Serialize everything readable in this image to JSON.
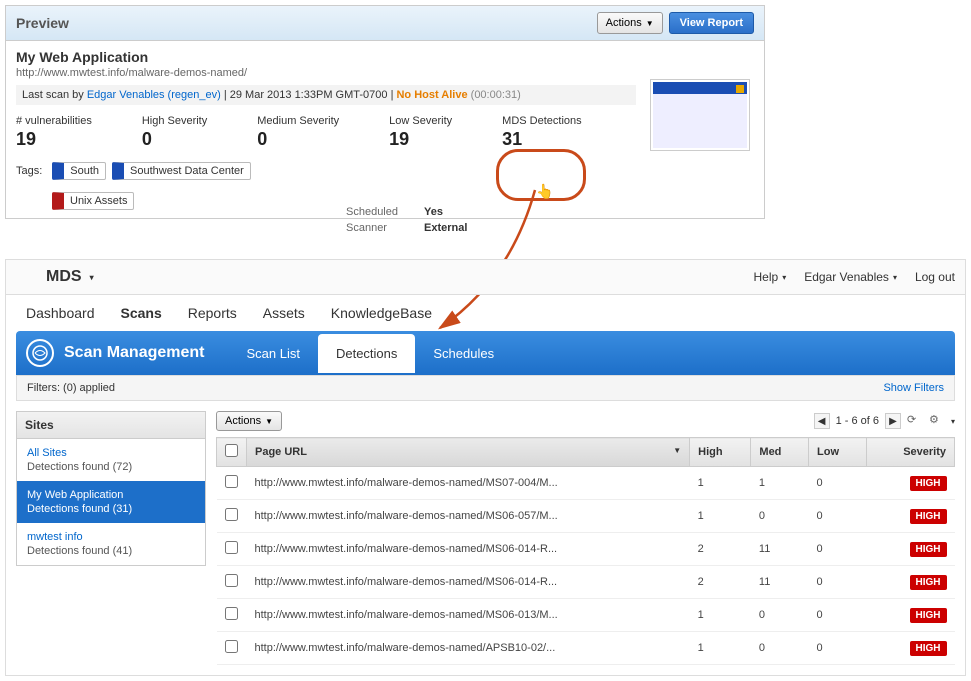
{
  "preview": {
    "title": "Preview",
    "actions_label": "Actions",
    "view_report_label": "View Report",
    "app_name": "My Web Application",
    "app_url": "http://www.mwtest.info/malware-demos-named/",
    "scan_prefix": "Last scan by ",
    "scan_user": "Edgar Venables (regen_ev)",
    "scan_sep1": " | ",
    "scan_date": "29 Mar 2013 1:33PM GMT-0700",
    "scan_sep2": " | ",
    "scan_status": "No Host Alive",
    "scan_duration": "(00:00:31)",
    "stats": [
      {
        "label": "# vulnerabilities",
        "value": "19"
      },
      {
        "label": "High Severity",
        "value": "0"
      },
      {
        "label": "Medium Severity",
        "value": "0"
      },
      {
        "label": "Low Severity",
        "value": "19"
      },
      {
        "label": "MDS Detections",
        "value": "31"
      }
    ],
    "tags_label": "Tags:",
    "tags": [
      {
        "text": "South",
        "color": "blue"
      },
      {
        "text": "Southwest Data Center",
        "color": "blue"
      },
      {
        "text": "Unix Assets",
        "color": "red"
      }
    ],
    "meta": {
      "scheduled_label": "Scheduled",
      "scheduled_value": "Yes",
      "scanner_label": "Scanner",
      "scanner_value": "External"
    }
  },
  "mds": {
    "brand": "MDS",
    "help_label": "Help",
    "user_name": "Edgar Venables",
    "logout_label": "Log out",
    "nav": [
      "Dashboard",
      "Scans",
      "Reports",
      "Assets",
      "KnowledgeBase"
    ],
    "nav_active": "Scans",
    "page_title": "Scan Management",
    "tabs": [
      "Scan List",
      "Detections",
      "Schedules"
    ],
    "tab_active": "Detections",
    "filters_label": "Filters: (0) applied",
    "show_filters_label": "Show Filters",
    "sidebar_header": "Sites",
    "sites": [
      {
        "name": "All Sites",
        "count": "Detections found (72)"
      },
      {
        "name": "My Web Application",
        "count": "Detections found (31)",
        "active": true
      },
      {
        "name": "mwtest info",
        "count": "Detections found (41)"
      }
    ],
    "actions_label": "Actions",
    "pager_text": "1 - 6 of 6",
    "columns": {
      "url": "Page URL",
      "high": "High",
      "med": "Med",
      "low": "Low",
      "sev": "Severity"
    },
    "rows": [
      {
        "url": "http://www.mwtest.info/malware-demos-named/MS07-004/M...",
        "high": "1",
        "med": "1",
        "low": "0",
        "sev": "HIGH"
      },
      {
        "url": "http://www.mwtest.info/malware-demos-named/MS06-057/M...",
        "high": "1",
        "med": "0",
        "low": "0",
        "sev": "HIGH"
      },
      {
        "url": "http://www.mwtest.info/malware-demos-named/MS06-014-R...",
        "high": "2",
        "med": "11",
        "low": "0",
        "sev": "HIGH"
      },
      {
        "url": "http://www.mwtest.info/malware-demos-named/MS06-014-R...",
        "high": "2",
        "med": "11",
        "low": "0",
        "sev": "HIGH"
      },
      {
        "url": "http://www.mwtest.info/malware-demos-named/MS06-013/M...",
        "high": "1",
        "med": "0",
        "low": "0",
        "sev": "HIGH"
      },
      {
        "url": "http://www.mwtest.info/malware-demos-named/APSB10-02/...",
        "high": "1",
        "med": "0",
        "low": "0",
        "sev": "HIGH"
      }
    ]
  }
}
